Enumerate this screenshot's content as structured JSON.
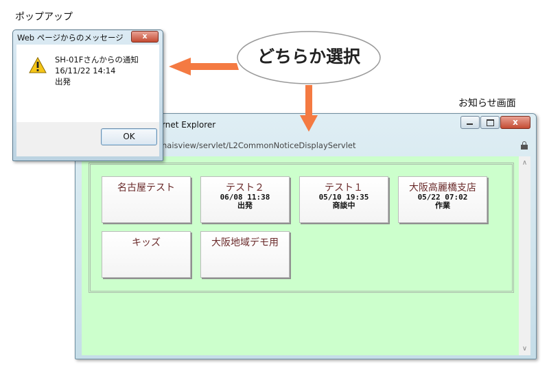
{
  "captions": {
    "popup": "ポップアップ",
    "notice": "お知らせ画面"
  },
  "callout": {
    "text": "どちらか選択"
  },
  "dialog": {
    "title": "Web ページからのメッセージ",
    "close": "x",
    "icon": "warning-icon",
    "message": [
      "SH-01Fさんからの通知",
      "16/11/22 14:14",
      "出発"
    ],
    "ok_label": "OK"
  },
  "browser": {
    "title": "rnet Explorer",
    "address": "naisview/servlet/L2CommonNoticeDisplayServlet",
    "buttons": {
      "close": "x"
    }
  },
  "notices": [
    {
      "title": "名古屋テスト",
      "lines": []
    },
    {
      "title": "テスト２",
      "lines": [
        "06/08 11:38",
        "出発"
      ]
    },
    {
      "title": "テスト１",
      "lines": [
        "05/10 19:35",
        "商談中"
      ]
    },
    {
      "title": "大阪高麗橋支店",
      "lines": [
        "05/22 07:02",
        "作業"
      ]
    },
    {
      "title": "キッズ",
      "lines": []
    },
    {
      "title": "大阪地域デモ用",
      "lines": []
    }
  ],
  "colors": {
    "content_bg": "#ccffcc",
    "arrow": "#f47a42",
    "button_text": "#6a2a2a"
  }
}
